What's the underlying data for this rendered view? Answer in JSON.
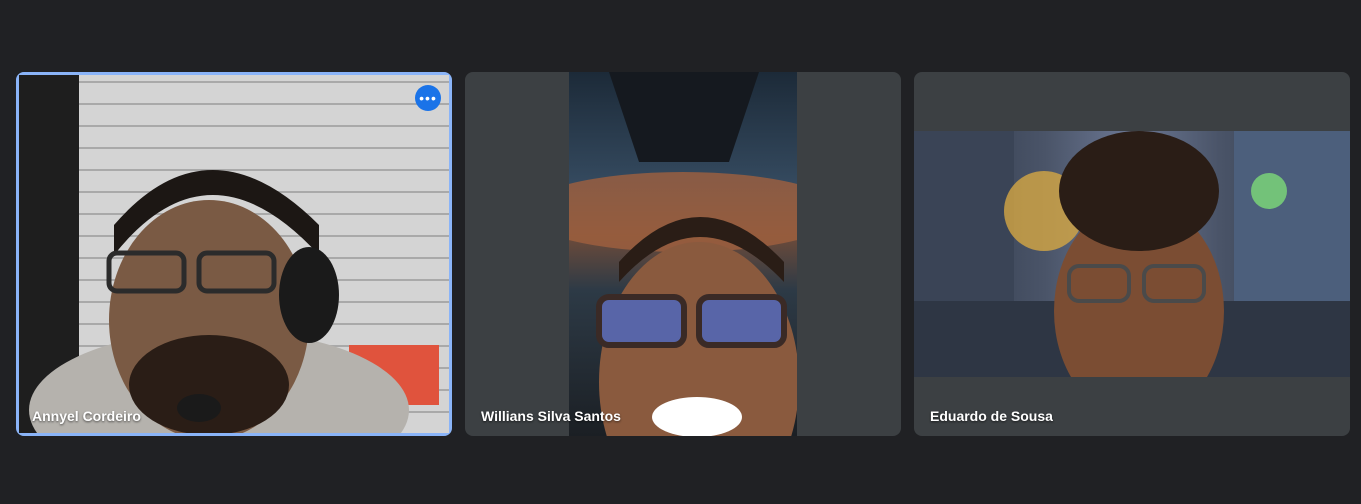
{
  "participants": [
    {
      "name": "Annyel Cordeiro",
      "active_speaker": true,
      "more_options_icon": "more-horiz-icon"
    },
    {
      "name": "Willians Silva Santos",
      "active_speaker": false
    },
    {
      "name": "Eduardo de Sousa",
      "active_speaker": false
    }
  ],
  "colors": {
    "background": "#202124",
    "tile": "#3c4043",
    "active_outline": "#8ab4f8",
    "button_blue": "#1a73e8"
  }
}
